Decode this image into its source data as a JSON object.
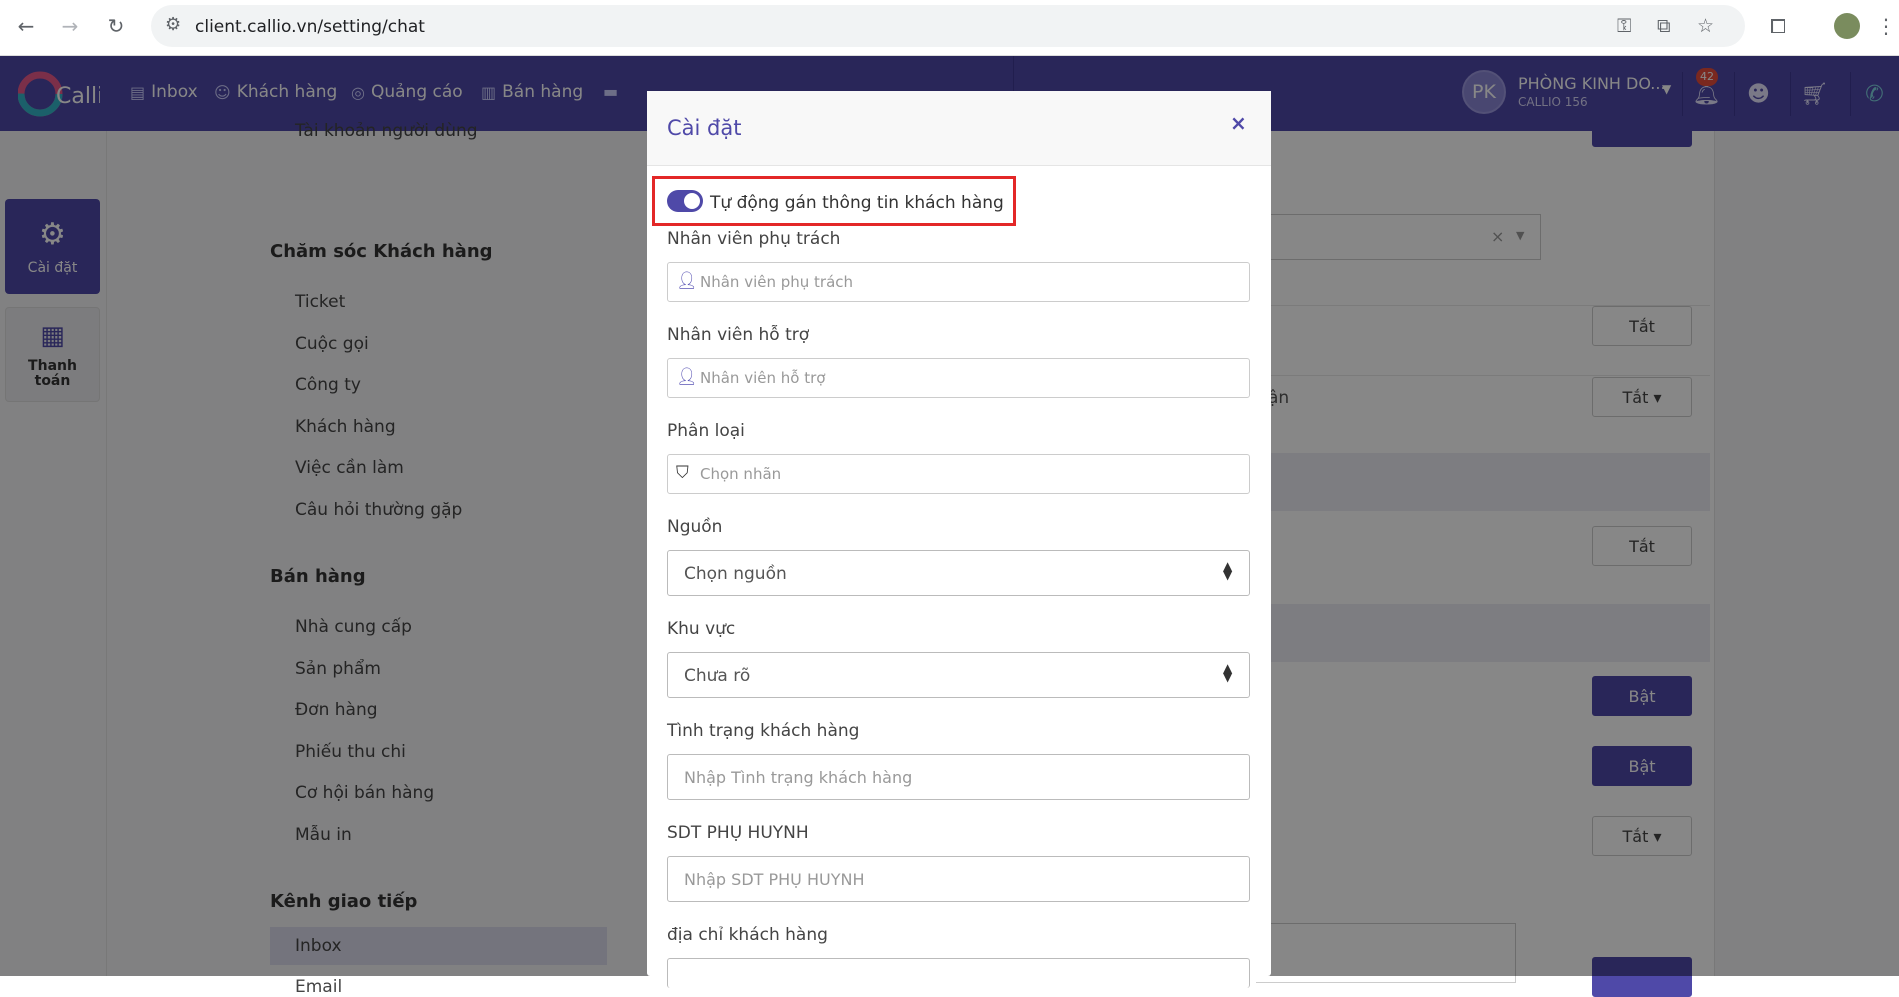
{
  "browser": {
    "url": "client.callio.vn/setting/chat"
  },
  "topnav": {
    "logo": "Callio",
    "items": [
      {
        "label": "Inbox",
        "icon": "inbox-icon"
      },
      {
        "label": "Khách hàng",
        "icon": "customer-icon"
      },
      {
        "label": "Quảng cáo",
        "icon": "ads-icon"
      },
      {
        "label": "Bán hàng",
        "icon": "store-icon"
      }
    ],
    "user": {
      "initials": "PK",
      "name": "PHÒNG KINH DO...",
      "ext": "CALLIO 156"
    },
    "notification_count": "42"
  },
  "rail": {
    "items": [
      {
        "label": "Cài đặt",
        "icon": "gear-icon"
      },
      {
        "label": "Thanh\ntoán",
        "icon": "receipt-icon"
      }
    ]
  },
  "menu": {
    "partial_top": "Tài khoản người dùng",
    "sections": [
      {
        "title": "Chăm sóc Khách hàng",
        "items": [
          "Ticket",
          "Cuộc gọi",
          "Công ty",
          "Khách hàng",
          "Việc cần làm",
          "Câu hỏi thường gặp"
        ]
      },
      {
        "title": "Bán hàng",
        "items": [
          "Nhà cung cấp",
          "Sản phẩm",
          "Đơn hàng",
          "Phiếu thu chi",
          "Cơ hội bán hàng",
          "Mẫu in"
        ]
      },
      {
        "title": "Kênh giao tiếp",
        "items": [
          "Inbox",
          "Email"
        ]
      }
    ]
  },
  "panel": {
    "buttons": [
      "Tắt",
      "Tắt ▾",
      "Tắt",
      "Bật",
      "Bật",
      "Tắt ▾"
    ],
    "partial_text": "ận"
  },
  "modal": {
    "title": "Cài đặt",
    "close": "×",
    "toggle": {
      "label": "Tự động gán thông tin khách hàng",
      "on": true
    },
    "fields": [
      {
        "label": "Nhân viên phụ trách",
        "placeholder": "Nhân viên phụ trách",
        "icon": "user-icon"
      },
      {
        "label": "Nhân viên hỗ trợ",
        "placeholder": "Nhân viên hỗ trợ",
        "icon": "user-icon"
      },
      {
        "label": "Phân loại",
        "placeholder": "Chọn nhãn",
        "icon": "tags-icon"
      },
      {
        "label": "Nguồn",
        "value": "Chọn nguồn"
      },
      {
        "label": "Khu vực",
        "value": "Chưa rõ"
      },
      {
        "label": "Tình trạng khách hàng",
        "placeholder": "Nhập Tình trạng khách hàng"
      },
      {
        "label": "SDT PHỤ HUYNH",
        "placeholder": "Nhập SDT PHỤ HUYNH"
      },
      {
        "label": "địa chỉ khách hàng"
      }
    ]
  }
}
